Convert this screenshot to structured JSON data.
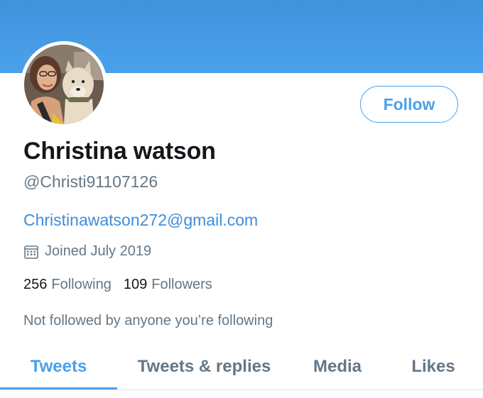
{
  "profile": {
    "display_name": "Christina watson",
    "handle": "@Christi91107126",
    "bio_link": "Christinawatson272@gmail.com",
    "joined": "Joined July 2019",
    "following_count": "256",
    "following_label": "Following",
    "followers_count": "109",
    "followers_label": "Followers",
    "not_followed_text": "Not followed by anyone you’re following"
  },
  "actions": {
    "follow_label": "Follow"
  },
  "tabs": [
    {
      "label": "Tweets",
      "active": true
    },
    {
      "label": "Tweets & replies",
      "active": false
    },
    {
      "label": "Media",
      "active": false
    },
    {
      "label": "Likes",
      "active": false
    }
  ],
  "colors": {
    "banner": "#4aa1ea",
    "accent": "#4aa1eb",
    "link": "#3e8ed8",
    "muted": "#657786",
    "text": "#14171a"
  },
  "icons": {
    "joined": "calendar-icon"
  }
}
